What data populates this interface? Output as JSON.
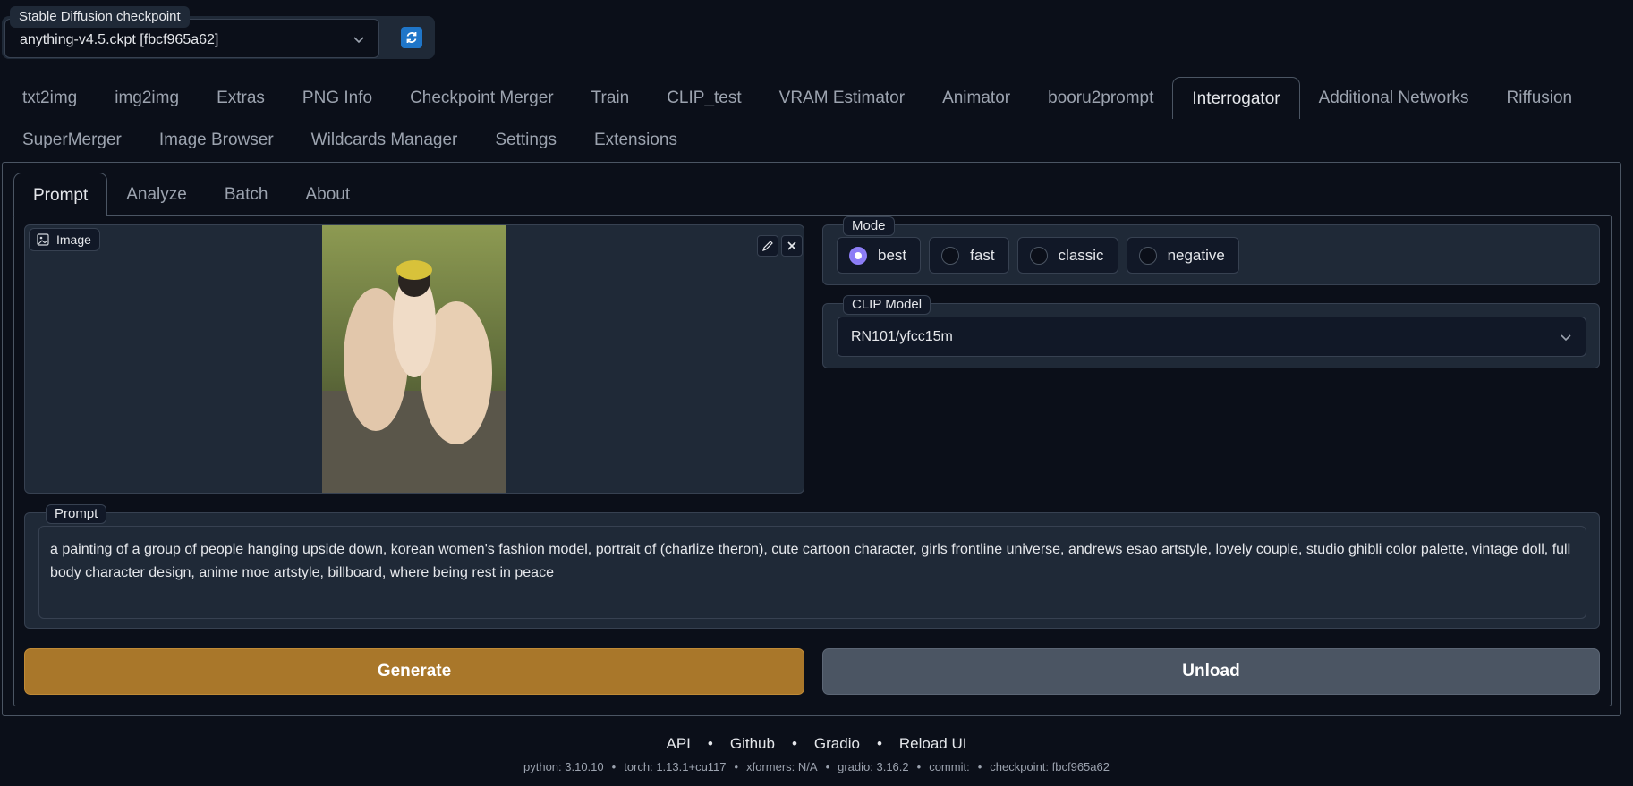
{
  "checkpoint": {
    "label": "Stable Diffusion checkpoint",
    "value": "anything-v4.5.ckpt [fbcf965a62]",
    "refresh_icon": "refresh-icon",
    "accent_color": "#1f76c9"
  },
  "main_tabs": [
    {
      "label": "txt2img",
      "active": false
    },
    {
      "label": "img2img",
      "active": false
    },
    {
      "label": "Extras",
      "active": false
    },
    {
      "label": "PNG Info",
      "active": false
    },
    {
      "label": "Checkpoint Merger",
      "active": false
    },
    {
      "label": "Train",
      "active": false
    },
    {
      "label": "CLIP_test",
      "active": false
    },
    {
      "label": "VRAM Estimator",
      "active": false
    },
    {
      "label": "Animator",
      "active": false
    },
    {
      "label": "booru2prompt",
      "active": false
    },
    {
      "label": "Interrogator",
      "active": true
    },
    {
      "label": "Additional Networks",
      "active": false
    },
    {
      "label": "Riffusion",
      "active": false
    },
    {
      "label": "SuperMerger",
      "active": false
    },
    {
      "label": "Image Browser",
      "active": false
    },
    {
      "label": "Wildcards Manager",
      "active": false
    },
    {
      "label": "Settings",
      "active": false
    },
    {
      "label": "Extensions",
      "active": false
    }
  ],
  "sub_tabs": [
    {
      "label": "Prompt",
      "active": true
    },
    {
      "label": "Analyze",
      "active": false
    },
    {
      "label": "Batch",
      "active": false
    },
    {
      "label": "About",
      "active": false
    }
  ],
  "image": {
    "label": "Image",
    "edit_icon": "pencil-icon",
    "close_icon": "close-icon"
  },
  "mode": {
    "label": "Mode",
    "options": [
      "best",
      "fast",
      "classic",
      "negative"
    ],
    "selected": "best",
    "selected_color": "#8b7cf6"
  },
  "clip_model": {
    "label": "CLIP Model",
    "value": "RN101/yfcc15m"
  },
  "prompt": {
    "label": "Prompt",
    "value": "a painting of a group of people hanging upside down, korean women's fashion model, portrait of (charlize theron), cute cartoon character, girls frontline universe, andrews esao artstyle, lovely couple, studio ghibli color palette, vintage doll, full body character design, anime moe artstyle, billboard, where being rest in peace"
  },
  "buttons": {
    "generate": "Generate",
    "generate_color": "#a9772a",
    "unload": "Unload",
    "unload_color": "#4b5563"
  },
  "footer": {
    "links": [
      "API",
      "Github",
      "Gradio",
      "Reload UI"
    ],
    "info": [
      "python: 3.10.10",
      "torch: 1.13.1+cu117",
      "xformers: N/A",
      "gradio: 3.16.2",
      "commit:",
      "checkpoint: fbcf965a62"
    ]
  }
}
